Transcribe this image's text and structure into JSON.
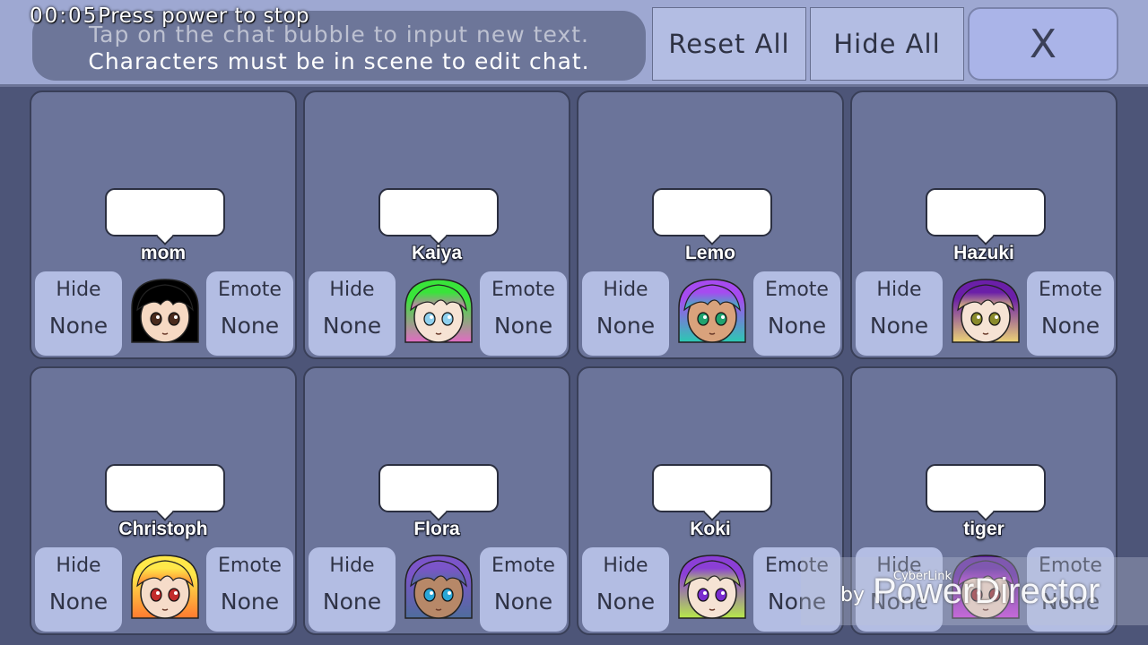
{
  "header": {
    "info_line1": "Tap on the chat bubble to input new text.",
    "info_line2": "Characters must be in scene to edit chat.",
    "reset_all_label": "Reset All",
    "hide_all_label": "Hide All",
    "close_label": "X"
  },
  "recording": {
    "timer": "00:05",
    "message": "Press power to stop"
  },
  "characters": [
    {
      "name": "mom",
      "hide_label": "Hide",
      "hide_value": "None",
      "emote_label": "Emote",
      "emote_value": "None",
      "hair_top": "#000000",
      "hair_bottom": "#000000",
      "eye_color": "#4a2b1d",
      "skin": "#f6d9c3"
    },
    {
      "name": "Kaiya",
      "hide_label": "Hide",
      "hide_value": "None",
      "emote_label": "Emote",
      "emote_value": "None",
      "hair_top": "#39e43a",
      "hair_bottom": "#e26bc4",
      "eye_color": "#8fd0ee",
      "skin": "#f6e3d4"
    },
    {
      "name": "Lemo",
      "hide_label": "Hide",
      "hide_value": "None",
      "emote_label": "Emote",
      "emote_value": "None",
      "hair_top": "#a64bf0",
      "hair_bottom": "#2bc9b2",
      "eye_color": "#1fa36f",
      "skin": "#d9a27c"
    },
    {
      "name": "Hazuki",
      "hide_label": "Hide",
      "hide_value": "None",
      "emote_label": "Emote",
      "emote_value": "None",
      "hair_top": "#6b1fa8",
      "hair_bottom": "#ecd376",
      "eye_color": "#8a8b2c",
      "skin": "#f6e3d4"
    },
    {
      "name": "Christoph",
      "hide_label": "Hide",
      "hide_value": "None",
      "emote_label": "Emote",
      "emote_value": "None",
      "hair_top": "#ffe84a",
      "hair_bottom": "#ff7a30",
      "eye_color": "#c22b2b",
      "skin": "#f6dcc9"
    },
    {
      "name": "Flora",
      "hide_label": "Hide",
      "hide_value": "None",
      "emote_label": "Emote",
      "emote_value": "None",
      "hair_top": "#7b55c9",
      "hair_bottom": "#4f6d9c",
      "eye_color": "#2aa6d6",
      "skin": "#b78868"
    },
    {
      "name": "Koki",
      "hide_label": "Hide",
      "hide_value": "None",
      "emote_label": "Emote",
      "emote_value": "None",
      "hair_top": "#8b3fd6",
      "hair_bottom": "#b7e94a",
      "eye_color": "#7a2ccf",
      "skin": "#f6e3d4"
    },
    {
      "name": "tiger",
      "hide_label": "Hide",
      "hide_value": "None",
      "emote_label": "Emote",
      "emote_value": "None",
      "hair_top": "#5e1f9c",
      "hair_bottom": "#c93bd8",
      "eye_color": "#a42b2b",
      "skin": "#f0d2bd"
    }
  ],
  "watermark": {
    "by": "by",
    "brand": "CyberLink",
    "product": "PowerDirector"
  }
}
